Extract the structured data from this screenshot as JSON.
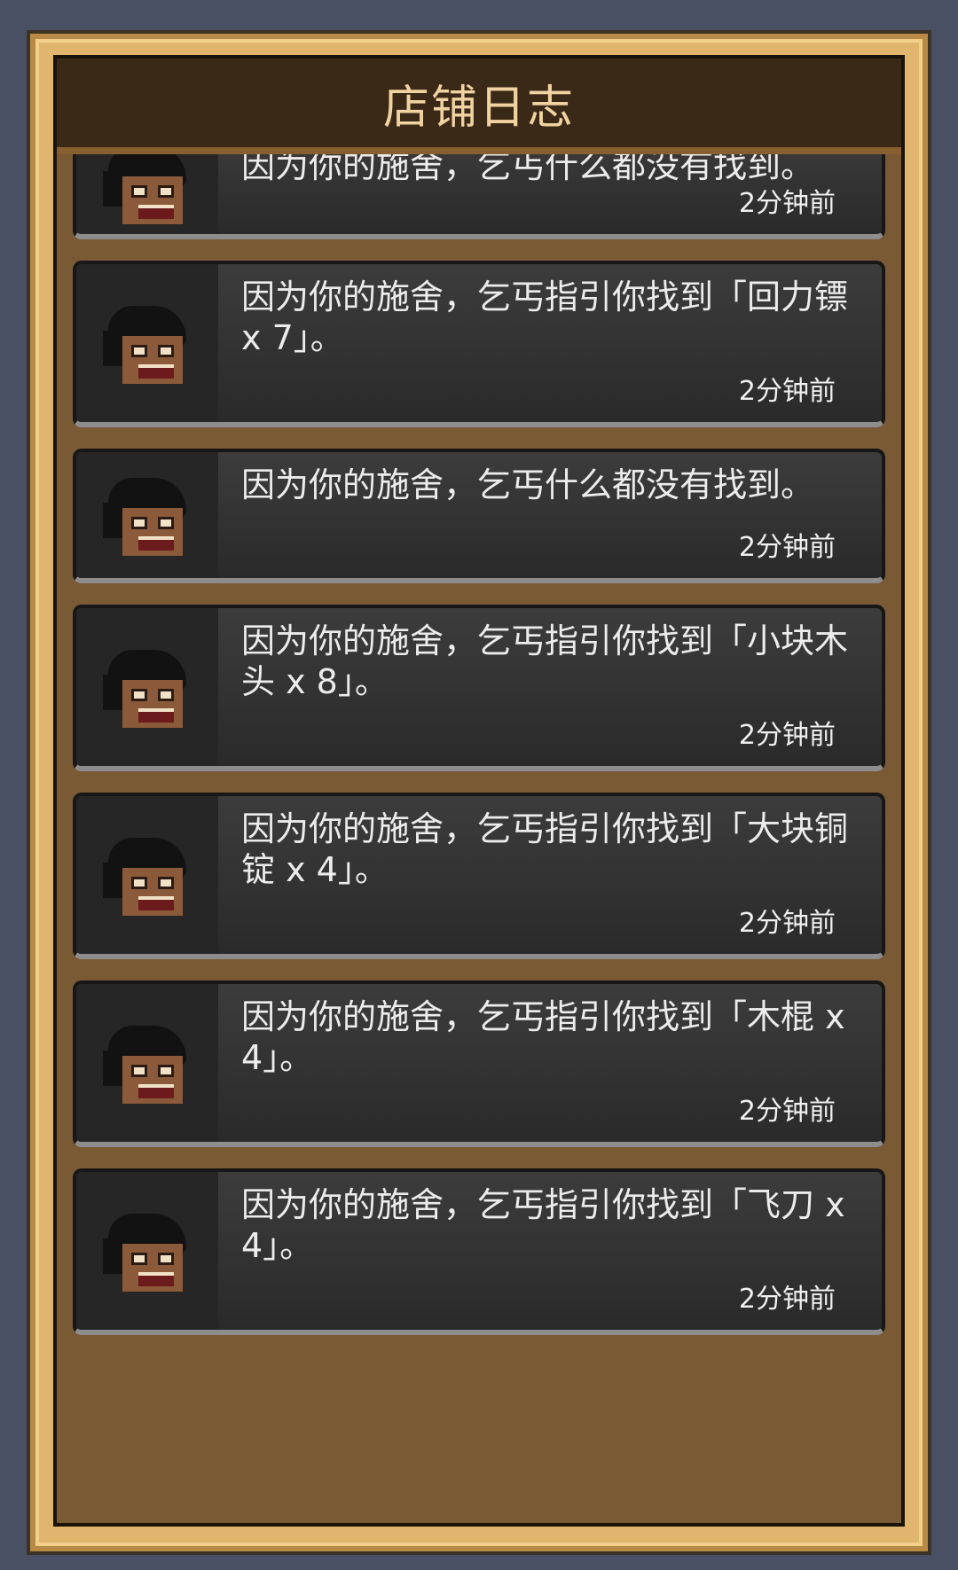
{
  "panel": {
    "title": "店铺日志"
  },
  "entries": [
    {
      "message": "因为你的施舍，乞丐什么都没有找到。",
      "time": "2分钟前"
    },
    {
      "message": "因为你的施舍，乞丐指引你找到「回力镖 x 7」。",
      "time": "2分钟前"
    },
    {
      "message": "因为你的施舍，乞丐什么都没有找到。",
      "time": "2分钟前"
    },
    {
      "message": "因为你的施舍，乞丐指引你找到「小块木头 x 8」。",
      "time": "2分钟前"
    },
    {
      "message": "因为你的施舍，乞丐指引你找到「大块铜锭 x 4」。",
      "time": "2分钟前"
    },
    {
      "message": "因为你的施舍，乞丐指引你找到「木棍 x 4」。",
      "time": "2分钟前"
    },
    {
      "message": "因为你的施舍，乞丐指引你找到「飞刀 x 4」。",
      "time": "2分钟前"
    }
  ],
  "colors": {
    "background": "#4a5063",
    "frame_gold": "#e0b56e",
    "title_text": "#f1d3a2",
    "entry_bg": "#2f2f2f"
  }
}
